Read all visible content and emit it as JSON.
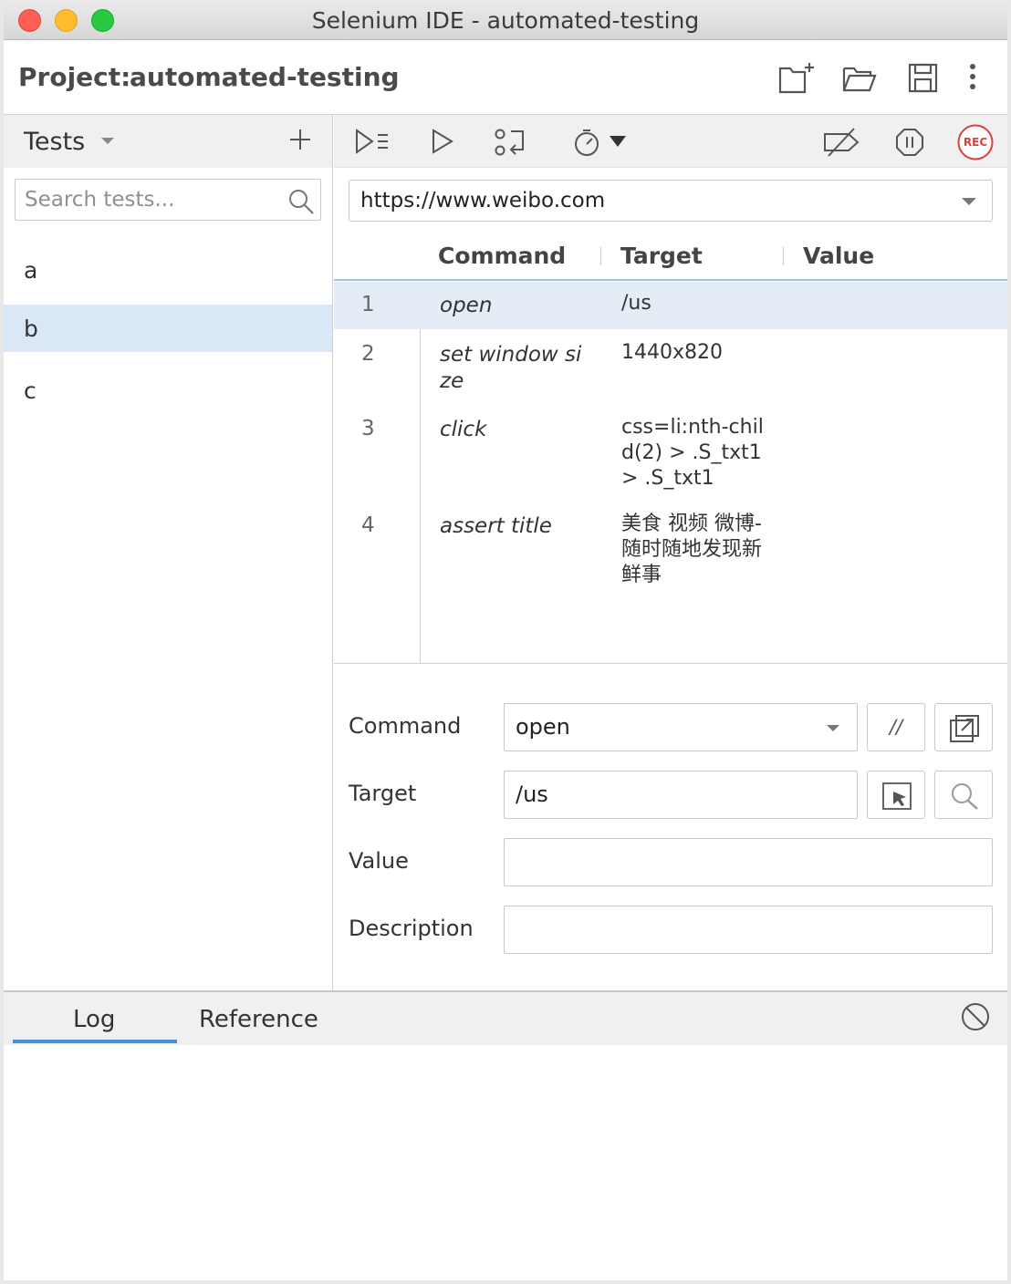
{
  "window": {
    "title": "Selenium IDE - automated-testing"
  },
  "project": {
    "label": "Project:",
    "name": "automated-testing"
  },
  "header_icons": [
    "new-project-icon",
    "open-project-icon",
    "save-project-icon",
    "more-options-icon"
  ],
  "sidebar": {
    "section_label": "Tests",
    "search_placeholder": "Search tests...",
    "tests": [
      {
        "name": "a",
        "selected": false
      },
      {
        "name": "b",
        "selected": true
      },
      {
        "name": "c",
        "selected": false
      }
    ]
  },
  "toolbar": {
    "icons": [
      "run-all-tests-icon",
      "run-current-test-icon",
      "step-over-icon",
      "speed-icon",
      "disable-breakpoints-icon",
      "pause-on-exceptions-icon",
      "record-icon"
    ],
    "record_label": "REC"
  },
  "url": {
    "value": "https://www.weibo.com"
  },
  "table": {
    "columns": [
      "Command",
      "Target",
      "Value"
    ],
    "rows": [
      {
        "num": "1",
        "command": "open",
        "target": "/us",
        "value": "",
        "selected": true
      },
      {
        "num": "2",
        "command": "set window size",
        "target": "1440x820",
        "value": "",
        "selected": false
      },
      {
        "num": "3",
        "command": "click",
        "target": "css=li:nth-child(2) > .S_txt1 > .S_txt1",
        "value": "",
        "selected": false
      },
      {
        "num": "4",
        "command": "assert title",
        "target": "美食 视频 微博-随时随地发现新鲜事",
        "value": "",
        "selected": false
      }
    ]
  },
  "editor": {
    "command_label": "Command",
    "command_value": "open",
    "comment_button": "//",
    "target_label": "Target",
    "target_value": "/us",
    "value_label": "Value",
    "value_value": "",
    "description_label": "Description",
    "description_value": ""
  },
  "bottom": {
    "tabs": [
      "Log",
      "Reference"
    ],
    "active_tab": "Log"
  },
  "colors": {
    "accent": "#4a90d9",
    "selected_row": "#e4ecf5",
    "selected_test": "#d9e7f7",
    "record": "#d9413a"
  }
}
